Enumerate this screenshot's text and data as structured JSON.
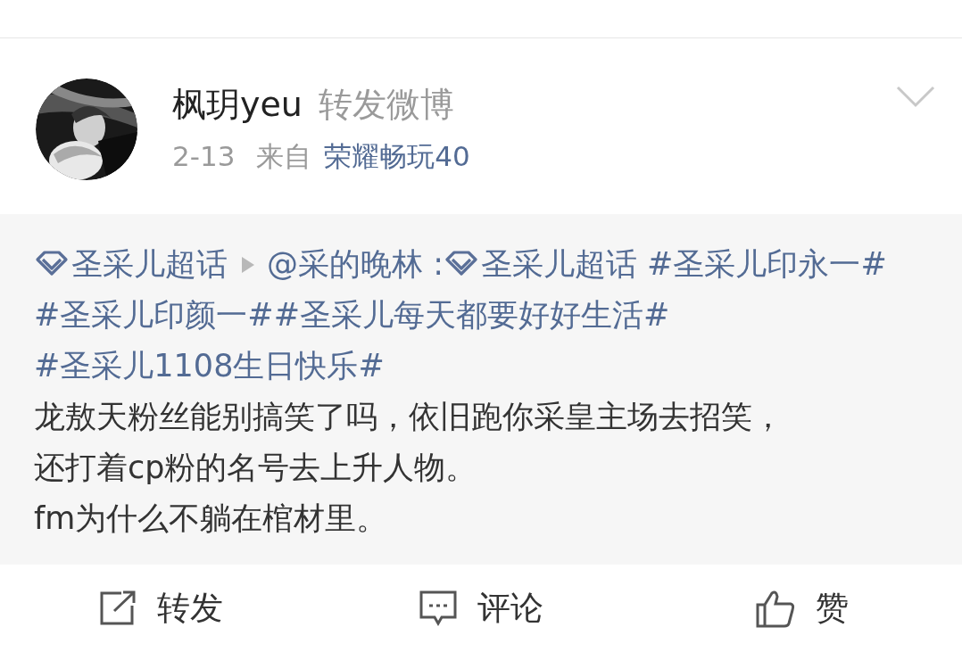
{
  "post": {
    "author": "枫玥yeu",
    "action": "转发微博",
    "date": "2-13",
    "source_prefix": "来自",
    "source": "荣耀畅玩40"
  },
  "repost": {
    "topic": "圣采儿超话",
    "mention": "@采的晚林",
    "colon": ":",
    "topic_2": "圣采儿超话",
    "hashtags": [
      "#圣采儿印永一#",
      "#圣采儿印颜一#",
      "#圣采儿每天都要好好生活#",
      "#圣采儿1108生日快乐#"
    ],
    "body": [
      "龙敖天粉丝能别搞笑了吗，依旧跑你采皇主场去招笑，",
      "还打着cp粉的名号去上升人物。",
      "fm为什么不躺在棺材里。"
    ]
  },
  "actions": [
    {
      "kind": "repost",
      "label": "转发"
    },
    {
      "kind": "comment",
      "label": "评论"
    },
    {
      "kind": "like",
      "label": "赞"
    }
  ]
}
